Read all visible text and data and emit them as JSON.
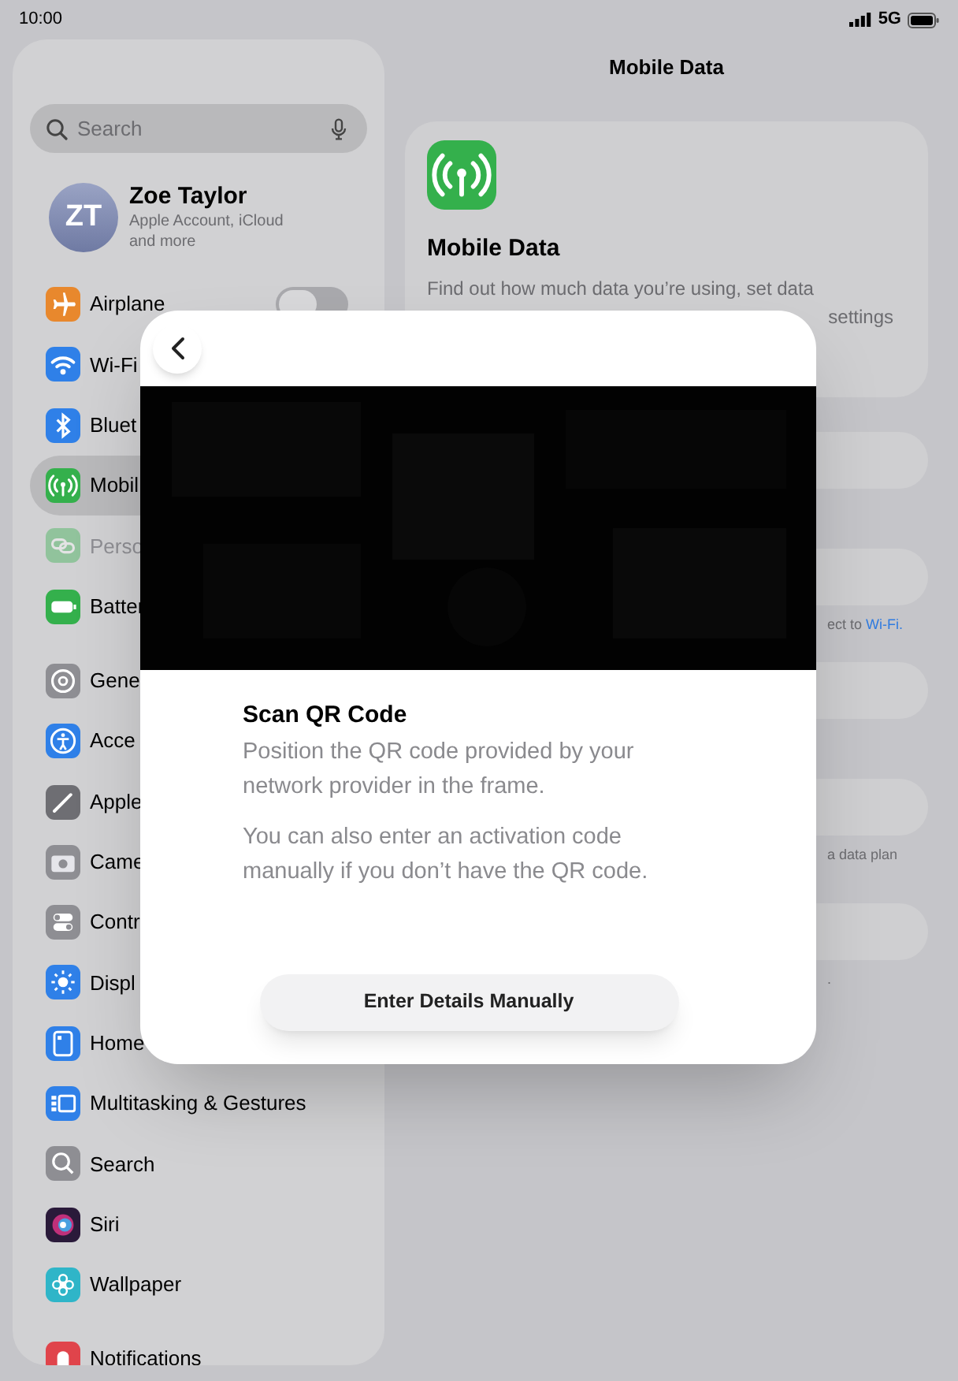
{
  "status_bar": {
    "time": "10:00",
    "network": "5G"
  },
  "sidebar": {
    "search": {
      "placeholder": "Search"
    },
    "profile": {
      "initials": "ZT",
      "name": "Zoe Taylor",
      "subtitle": "Apple Account, iCloud and more"
    },
    "groups": [
      [
        {
          "kind": "airplane",
          "label": "Airplane",
          "selected": false,
          "disabled": false,
          "toggle": {
            "on": false
          }
        },
        {
          "kind": "wifi",
          "label": "Wi-Fi",
          "selected": false,
          "disabled": false
        },
        {
          "kind": "bluetooth",
          "label": "Bluet",
          "selected": false,
          "disabled": false
        },
        {
          "kind": "antenna",
          "label": "Mobil",
          "selected": true,
          "disabled": false
        },
        {
          "kind": "link",
          "label": "Perso",
          "selected": false,
          "disabled": true
        },
        {
          "kind": "battery",
          "label": "Batter",
          "selected": false,
          "disabled": false
        }
      ],
      [
        {
          "kind": "gear",
          "label": "Gene",
          "selected": false,
          "disabled": false
        },
        {
          "kind": "accessibility",
          "label": "Acce",
          "selected": false,
          "disabled": false
        },
        {
          "kind": "pencil",
          "label": "Apple",
          "selected": false,
          "disabled": false
        },
        {
          "kind": "camera",
          "label": "Came",
          "selected": false,
          "disabled": false
        },
        {
          "kind": "toggles",
          "label": "Contr",
          "selected": false,
          "disabled": false
        },
        {
          "kind": "sun",
          "label": "Displ",
          "selected": false,
          "disabled": false
        },
        {
          "kind": "home",
          "label": "Home",
          "selected": false,
          "disabled": false
        },
        {
          "kind": "multitask",
          "label": "Multitasking & Gestures",
          "selected": false,
          "disabled": false
        },
        {
          "kind": "search",
          "label": "Search",
          "selected": false,
          "disabled": false
        },
        {
          "kind": "siri",
          "label": "Siri",
          "selected": false,
          "disabled": false
        },
        {
          "kind": "flower",
          "label": "Wallpaper",
          "selected": false,
          "disabled": false
        }
      ],
      [
        {
          "kind": "bell",
          "label": "Notifications",
          "selected": false,
          "disabled": false
        }
      ]
    ]
  },
  "detail": {
    "title": "Mobile Data",
    "card": {
      "heading": "Mobile Data",
      "description": "Find out how much data you’re using, set data",
      "description_end": "settings"
    },
    "footnotes": [
      {
        "text": "ect to ",
        "link": "Wi-Fi."
      },
      {
        "text": "a data plan"
      },
      {
        "text": "."
      }
    ]
  },
  "sheet": {
    "title": "Scan QR Code",
    "paragraphs": [
      "Position the QR code provided by your network provider in the frame.",
      "You can also enter an activation code manually if you don’t have the QR code."
    ],
    "button": "Enter Details Manually"
  }
}
